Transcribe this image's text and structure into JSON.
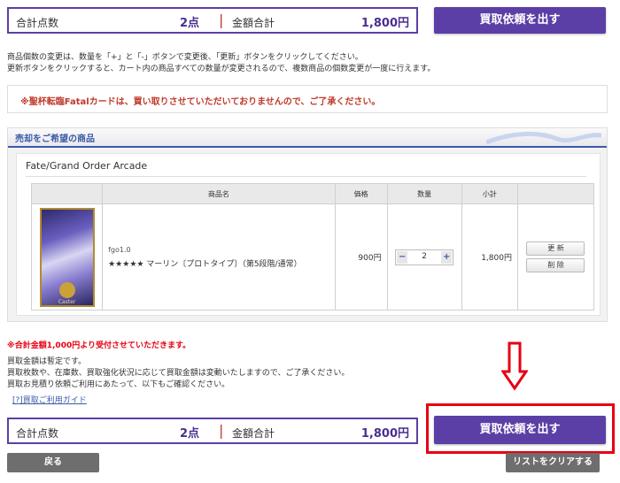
{
  "summary": {
    "count_label": "合計点数",
    "count_value": "2点",
    "separator": "|",
    "amount_label": "金額合計",
    "amount_value": "1,800円"
  },
  "submit_label": "買取依頼を出す",
  "notes": {
    "line1": "商品個数の変更は、数量を「+」と「-」ボタンで変更後、「更新」ボタンをクリックしてください。",
    "line2": "更新ボタンをクリックすると、カート内の商品すべての数量が変更されるので、複数商品の個数変更が一度に行えます。"
  },
  "warning": "※聖杯転臨Fatalカードは、買い取りさせていただいておりませんので、ご了承ください。",
  "panel": {
    "title": "売却をご希望の商品",
    "game_title": "Fate/Grand Order Arcade",
    "columns": [
      "商品名",
      "価格",
      "数量",
      "小計"
    ],
    "item": {
      "code": "fgo1.0",
      "name": "★★★★★ マーリン〔プロトタイプ〕（第5段階/通常）",
      "card_caption": "Caster",
      "price": "900円",
      "qty_minus": "−",
      "qty": "2",
      "qty_plus": "+",
      "subtotal": "1,800円",
      "update_label": "更 新",
      "delete_label": "削 除"
    }
  },
  "min_notice": "※合計金額1,000円より受付させていただきます。",
  "info": {
    "line1": "買取金額は暫定です。",
    "line2": "買取枚数や、在庫数、買取強化状況に応じて買取金額は変動いたしますので、ご了承ください。",
    "line3": "買取お見積り依頼ご利用にあたって、以下もご確認ください。"
  },
  "guide_link": "[?]買取ご利用ガイド",
  "back_label": "戻る",
  "clear_label": "リストをクリアする",
  "colors": {
    "brand_purple": "#5b3fa6",
    "alert_red": "#e60012",
    "header_blue": "#3b5aa8"
  }
}
